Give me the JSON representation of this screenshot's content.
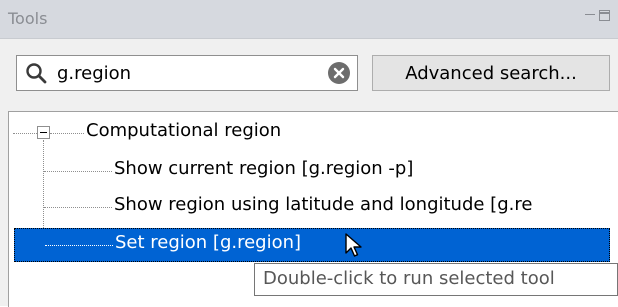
{
  "window": {
    "title": "Tools"
  },
  "search": {
    "value": "g.region",
    "advanced_label": "Advanced search..."
  },
  "tree": {
    "group_label": "Computational region",
    "items": [
      {
        "label": "Show current region  [g.region -p]"
      },
      {
        "label": "Show region using latitude and longitude  [g.re"
      },
      {
        "label": "Set region  [g.region]"
      }
    ],
    "selected_index": 2
  },
  "tooltip": {
    "text": "Double-click to run selected tool"
  },
  "colors": {
    "selection": "#0063d3",
    "titlebar": "#d6d9df"
  }
}
